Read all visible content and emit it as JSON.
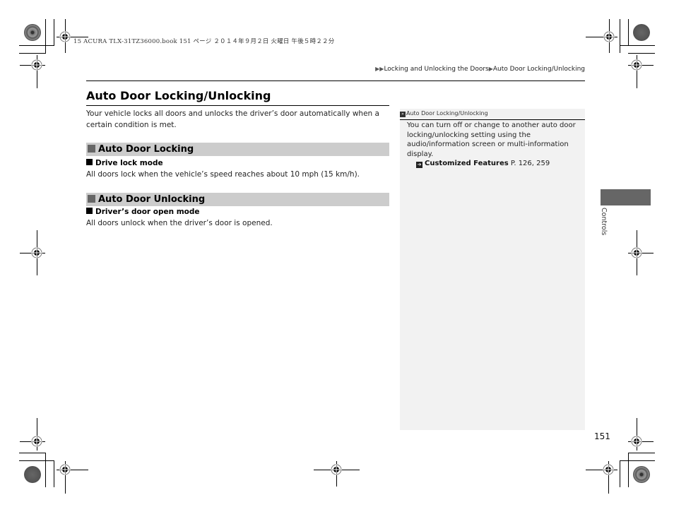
{
  "print_info": "15 ACURA TLX-31TZ36000.book  151 ページ  ２０１４年９月２日  火曜日  午後５時２２分",
  "breadcrumb": {
    "marker": "▶▶",
    "separator": "▶",
    "items": [
      "Locking and Unlocking the Doors",
      "Auto Door Locking/Unlocking"
    ]
  },
  "page": {
    "title": "Auto Door Locking/Unlocking",
    "intro": "Your vehicle locks all doors and unlocks the driver’s door automatically when a certain condition is met.",
    "sections": [
      {
        "heading": "Auto Door Locking",
        "sub_heading": "Drive lock mode",
        "text": "All doors lock when the vehicle’s speed reaches about 10 mph (15 km/h)."
      },
      {
        "heading": "Auto Door Unlocking",
        "sub_heading": "Driver’s door open mode",
        "text": "All doors unlock when the driver’s door is opened."
      }
    ]
  },
  "sidebar": {
    "heading_icon": "»",
    "heading": "Auto Door Locking/Unlocking",
    "body": "You can turn off or change to another auto door locking/unlocking setting using the audio/information screen or multi-information display.",
    "ref_icon": "➔",
    "ref_label": "Customized Features",
    "ref_pages": "P. 126, 259"
  },
  "chapter_tab": {
    "label": "Controls",
    "color": "#666666"
  },
  "page_number": "151"
}
